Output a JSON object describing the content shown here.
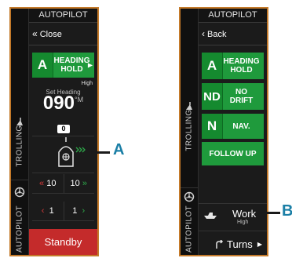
{
  "left_panel": {
    "title": "AUTOPILOT",
    "close_label": "Close",
    "mode_letter": "A",
    "mode_line1": "HEADING",
    "mode_line2": "HOLD",
    "response_level": "High",
    "set_heading_label": "Set Heading",
    "heading_value": "090",
    "heading_unit": "°M",
    "rudder_value": "0",
    "port_large": "10",
    "stbd_large": "10",
    "port_small": "1",
    "stbd_small": "1",
    "standby_label": "Standby",
    "tabs": {
      "trolling": "TROLLING",
      "autopilot": "AUTOPILOT"
    }
  },
  "right_panel": {
    "title": "AUTOPILOT",
    "back_label": "Back",
    "modes": [
      {
        "letter": "A",
        "line1": "HEADING",
        "line2": "HOLD"
      },
      {
        "letter": "ND",
        "line1": "NO DRIFT",
        "line2": ""
      },
      {
        "letter": "N",
        "line1": "NAV.",
        "line2": ""
      }
    ],
    "follow_up_label": "FOLLOW UP",
    "work_label": "Work",
    "work_level": "High",
    "turns_label": "Turns",
    "tabs": {
      "trolling": "TROLLING",
      "autopilot": "AUTOPILOT"
    }
  },
  "callouts": {
    "a": "A",
    "b": "B"
  },
  "colors": {
    "frame": "#c47a2a",
    "green": "#1f9a3c",
    "red": "#c42b2b",
    "callout": "#1b7fa6"
  }
}
